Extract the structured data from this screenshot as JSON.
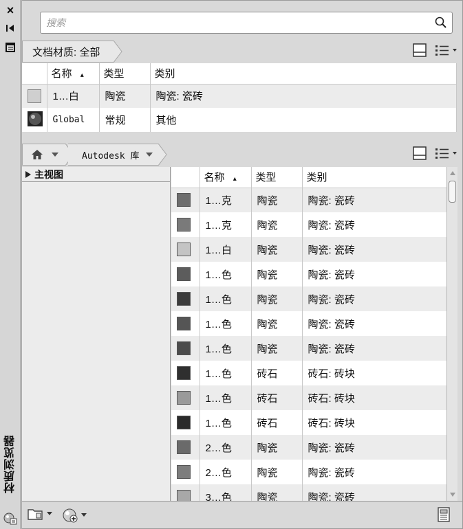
{
  "palette": {
    "title": "材质浏览器",
    "buttons": {
      "close": "×",
      "auto_hide": "⇤",
      "properties": "▤"
    }
  },
  "search": {
    "placeholder": "搜索"
  },
  "document_materials": {
    "breadcrumb": "文档材质: 全部",
    "columns": [
      "名称",
      "类型",
      "类别"
    ],
    "sort_indicator": "▴",
    "rows": [
      {
        "name": "1…白",
        "type": "陶瓷",
        "category": "陶瓷: 瓷砖",
        "swatch": "#c8c8c8"
      },
      {
        "name": "Global",
        "type": "常规",
        "category": "其他",
        "swatch": "#333333"
      }
    ]
  },
  "library": {
    "home_icon": "home-icon",
    "breadcrumb": "Autodesk 库",
    "tree_root": "主视图",
    "columns": [
      "名称",
      "类型",
      "类别"
    ],
    "sort_indicator": "▴",
    "rows": [
      {
        "name": "1…克",
        "type": "陶瓷",
        "category": "陶瓷: 瓷砖",
        "swatch": "#6d6d6d"
      },
      {
        "name": "1…克",
        "type": "陶瓷",
        "category": "陶瓷: 瓷砖",
        "swatch": "#7a7a7a"
      },
      {
        "name": "1…白",
        "type": "陶瓷",
        "category": "陶瓷: 瓷砖",
        "swatch": "#c4c4c4"
      },
      {
        "name": "1…色",
        "type": "陶瓷",
        "category": "陶瓷: 瓷砖",
        "swatch": "#5c5c5c"
      },
      {
        "name": "1…色",
        "type": "陶瓷",
        "category": "陶瓷: 瓷砖",
        "swatch": "#3c3c3c"
      },
      {
        "name": "1…色",
        "type": "陶瓷",
        "category": "陶瓷: 瓷砖",
        "swatch": "#555555"
      },
      {
        "name": "1…色",
        "type": "陶瓷",
        "category": "陶瓷: 瓷砖",
        "swatch": "#4c4c4c"
      },
      {
        "name": "1…色",
        "type": "砖石",
        "category": "砖石: 砖块",
        "swatch": "#2f2f2f"
      },
      {
        "name": "1…色",
        "type": "砖石",
        "category": "砖石: 砖块",
        "swatch": "#9a9a9a"
      },
      {
        "name": "1…色",
        "type": "砖石",
        "category": "砖石: 砖块",
        "swatch": "#2a2a2a"
      },
      {
        "name": "2…色",
        "type": "陶瓷",
        "category": "陶瓷: 瓷砖",
        "swatch": "#6a6a6a"
      },
      {
        "name": "2…色",
        "type": "陶瓷",
        "category": "陶瓷: 瓷砖",
        "swatch": "#7d7d7d"
      },
      {
        "name": "3…色",
        "type": "陶瓷",
        "category": "陶瓷: 瓷砖",
        "swatch": "#a8a8a8"
      }
    ]
  },
  "footer": {
    "icons": [
      "library-folder-icon",
      "create-material-icon",
      "editor-icon"
    ]
  }
}
